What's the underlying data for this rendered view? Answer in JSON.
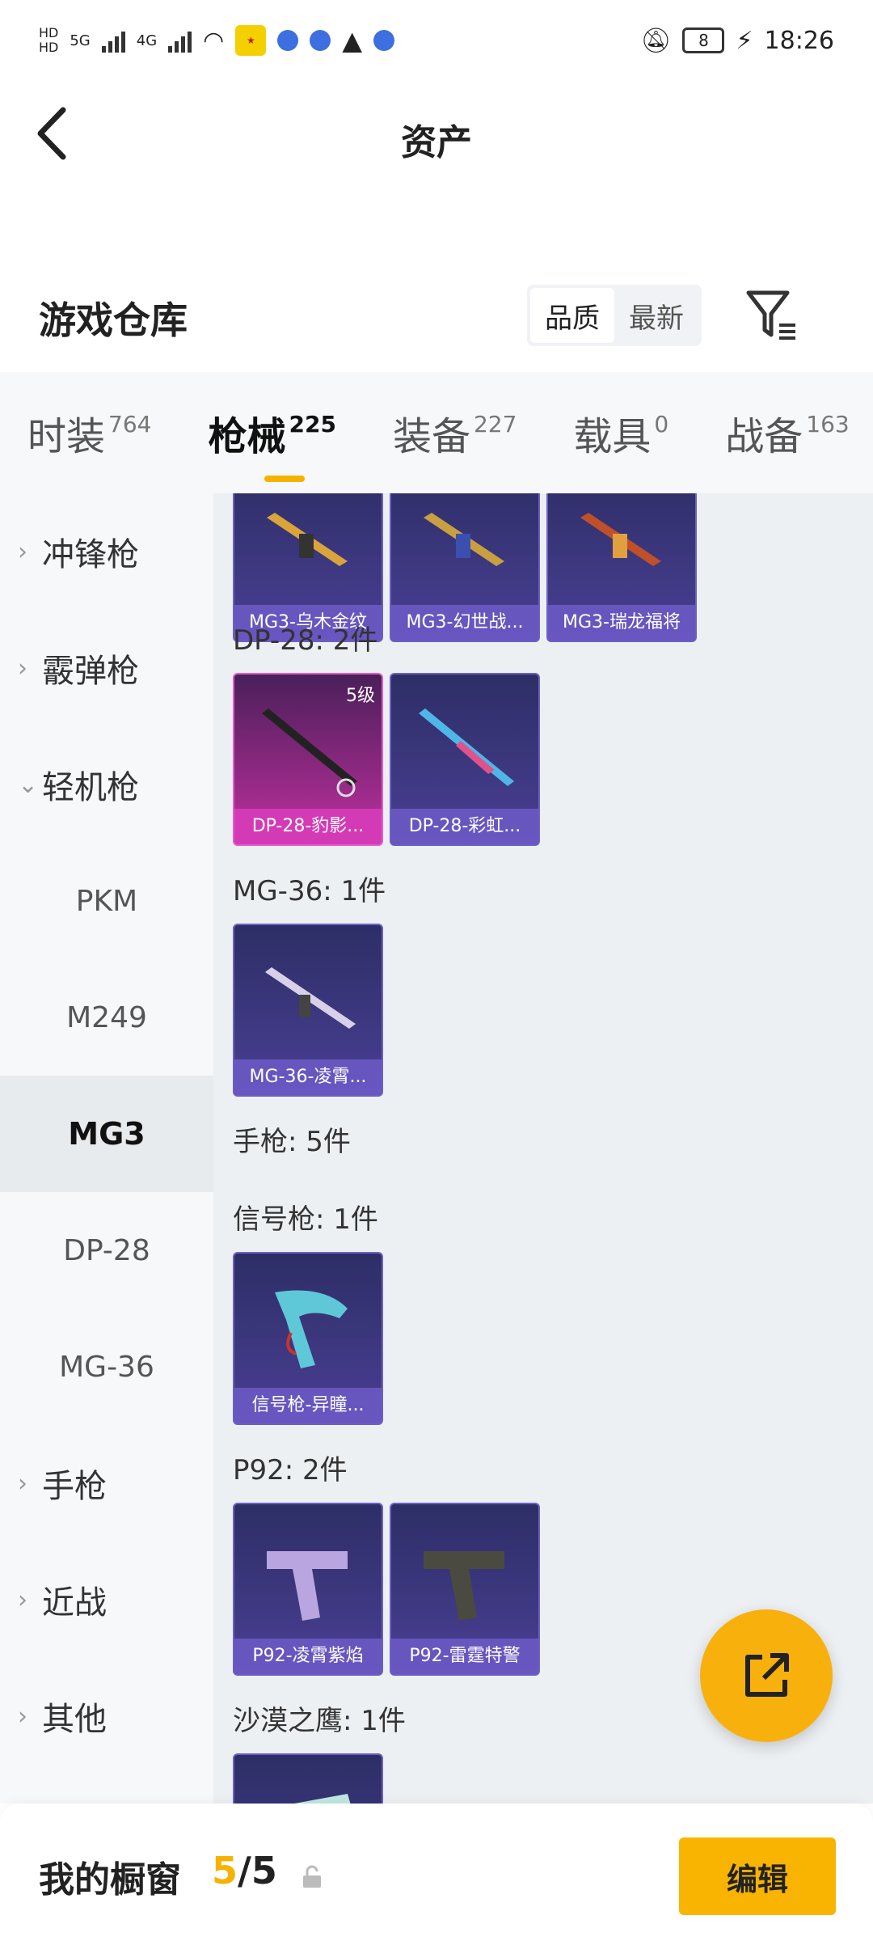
{
  "status_bar": {
    "time": "18:26",
    "battery": "8",
    "net_left": "5G",
    "net_right": "4G"
  },
  "header": {
    "title": "资产"
  },
  "warehouse": {
    "title": "游戏仓库",
    "sort_options": [
      "品质",
      "最新"
    ],
    "active_sort": "品质"
  },
  "tabs": [
    {
      "label": "时装",
      "count": "764"
    },
    {
      "label": "枪械",
      "count": "225"
    },
    {
      "label": "装备",
      "count": "227"
    },
    {
      "label": "载具",
      "count": "0"
    },
    {
      "label": "战备",
      "count": "163"
    }
  ],
  "active_tab": "枪械",
  "sidebar": {
    "items": [
      {
        "label": "冲锋枪",
        "type": "category"
      },
      {
        "label": "霰弹枪",
        "type": "category"
      },
      {
        "label": "轻机枪",
        "type": "category-open"
      },
      {
        "label": "PKM",
        "type": "sub"
      },
      {
        "label": "M249",
        "type": "sub"
      },
      {
        "label": "MG3",
        "type": "sub-selected"
      },
      {
        "label": "DP-28",
        "type": "sub"
      },
      {
        "label": "MG-36",
        "type": "sub"
      },
      {
        "label": "手枪",
        "type": "category"
      },
      {
        "label": "近战",
        "type": "category"
      },
      {
        "label": "其他",
        "type": "category"
      }
    ]
  },
  "content": {
    "top_cards": [
      {
        "name": "MG3-乌木金纹"
      },
      {
        "name": "MG3-幻世战..."
      },
      {
        "name": "MG3-瑞龙福将"
      }
    ],
    "groups": [
      {
        "label": "DP-28: 2件",
        "cards": [
          {
            "name": "DP-28-豹影...",
            "level": "5级"
          },
          {
            "name": "DP-28-彩虹..."
          }
        ]
      },
      {
        "label": "MG-36: 1件",
        "cards": [
          {
            "name": "MG-36-凌霄..."
          }
        ]
      },
      {
        "label": "手枪: 5件",
        "cards": []
      },
      {
        "label": "信号枪: 1件",
        "cards": [
          {
            "name": "信号枪-异瞳..."
          }
        ]
      },
      {
        "label": "P92: 2件",
        "cards": [
          {
            "name": "P92-凌霄紫焰"
          },
          {
            "name": "P92-雷霆特警"
          }
        ]
      },
      {
        "label": "沙漠之鹰: 1件",
        "cards": [
          {
            "name": ""
          }
        ]
      }
    ]
  },
  "bottom_bar": {
    "label": "我的橱窗",
    "count_current": "5",
    "count_sep": "/",
    "count_total": "5",
    "edit_label": "编辑"
  },
  "colors": {
    "accent": "#f8b400",
    "card_purple": "#4a3f94",
    "card_pink": "#c0309e"
  }
}
